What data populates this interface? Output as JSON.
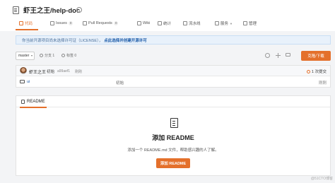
{
  "repo": {
    "title": "虾王之王/help-doc"
  },
  "tabs": [
    {
      "label": "代码",
      "icon": "code-icon",
      "active": true
    },
    {
      "label": "Issues",
      "badge": "0",
      "icon": "issues-icon"
    },
    {
      "label": "Pull Requests",
      "badge": "0",
      "icon": "pull-request-icon"
    },
    {
      "label": "Wiki",
      "icon": "wiki-icon"
    },
    {
      "label": "统计",
      "icon": "stats-icon"
    },
    {
      "label": "流水线",
      "icon": "pipeline-icon"
    },
    {
      "label": "服务",
      "icon": "service-icon",
      "dropdown": true
    },
    {
      "label": "管理",
      "icon": "manage-icon"
    }
  ],
  "notice": {
    "text": "你当前开源项目尚未选择许可证（LICENSE），",
    "link": "点此选择并创建开源许可"
  },
  "toolbar": {
    "branch": "master",
    "branches": "分支 1",
    "tags": "标签 0",
    "clone_button": "克隆/下载"
  },
  "commit": {
    "author": "虾王之王",
    "message": "初始",
    "hash": "a99aef1",
    "time": "刚刚",
    "count": "1 次提交"
  },
  "files": [
    {
      "name": "ui",
      "commit": "初始",
      "time": "刚刚"
    }
  ],
  "readme": {
    "tab_label": "README",
    "title": "添加 README",
    "description": "添加一个 README.md 文件，帮助感兴趣的人了解。",
    "button": "添加 README"
  },
  "watermark": "@51CTO博客",
  "colors": {
    "accent": "#e4702b",
    "link": "#1a5aa8",
    "notice_bg": "#e8f1fb"
  }
}
